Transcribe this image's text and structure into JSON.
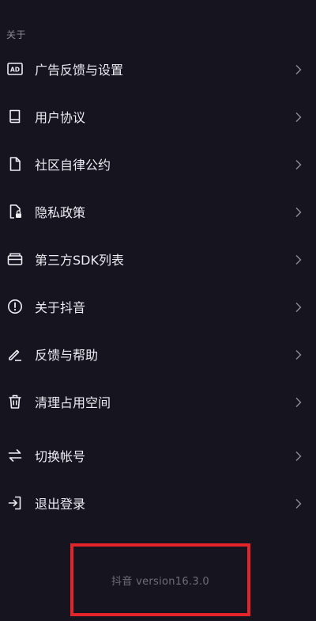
{
  "section": {
    "title": "关于"
  },
  "menu": {
    "items": [
      {
        "label": "广告反馈与设置",
        "icon": "ad-icon"
      },
      {
        "label": "用户协议",
        "icon": "book-icon"
      },
      {
        "label": "社区自律公约",
        "icon": "document-icon"
      },
      {
        "label": "隐私政策",
        "icon": "privacy-lock-icon"
      },
      {
        "label": "第三方SDK列表",
        "icon": "box-icon"
      },
      {
        "label": "关于抖音",
        "icon": "info-exclamation-icon"
      },
      {
        "label": "反馈与帮助",
        "icon": "pencil-icon"
      },
      {
        "label": "清理占用空间",
        "icon": "trash-icon"
      },
      {
        "label": "切换帐号",
        "icon": "swap-arrows-icon"
      },
      {
        "label": "退出登录",
        "icon": "logout-icon"
      }
    ]
  },
  "footer": {
    "version": "抖音 version16.3.0"
  },
  "colors": {
    "background": "#16151f",
    "highlight_border": "#e3242b"
  }
}
